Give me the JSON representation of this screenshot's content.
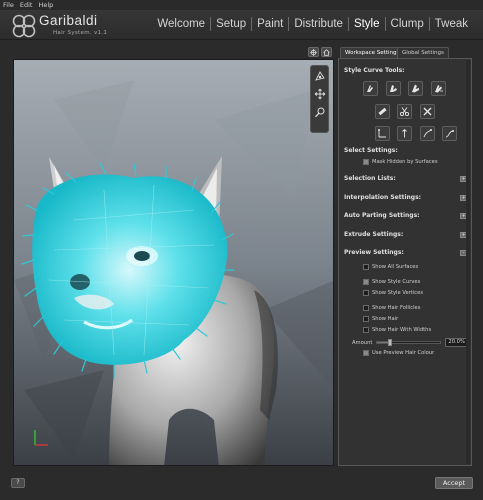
{
  "menu": {
    "file": "File",
    "edit": "Edit",
    "help": "Help"
  },
  "brand": {
    "name": "Garibaldi",
    "subtitle": "Hair System. v1.1"
  },
  "nav_tabs": [
    "Welcome",
    "Setup",
    "Paint",
    "Distribute",
    "Style",
    "Clump",
    "Tweak"
  ],
  "active_tab": "Style",
  "panel_tabs": {
    "workspace": "Workspace Settings",
    "global": "Global Settings"
  },
  "sections": {
    "style_curve_tools": "Style Curve Tools:",
    "select_settings": "Select Settings:",
    "mask_hidden": "Mask Hidden by Surfaces",
    "selection_lists": "Selection Lists:",
    "interpolation": "Interpolation Settings:",
    "auto_parting": "Auto Parting Settings:",
    "extrude": "Extrude Settings:",
    "preview": "Preview Settings:"
  },
  "preview_options": {
    "show_all_surfaces": "Show All Surfaces",
    "show_style_curves": "Show Style Curves",
    "show_style_vertices": "Show Style Vertices",
    "show_hair_follicles": "Show Hair Follicles",
    "show_hair": "Show Hair",
    "show_hair_widths": "Show Hair With Widths",
    "amount_label": "Amount",
    "amount_value": "20.0%",
    "amount_fraction": 0.2,
    "use_preview_colour": "Use Preview Hair Colour"
  },
  "footer": {
    "help": "?",
    "accept": "Accept"
  },
  "colors": {
    "hair_accent": "#39d0dc",
    "panel_bg": "#323232",
    "background": "#2b2b2b"
  }
}
